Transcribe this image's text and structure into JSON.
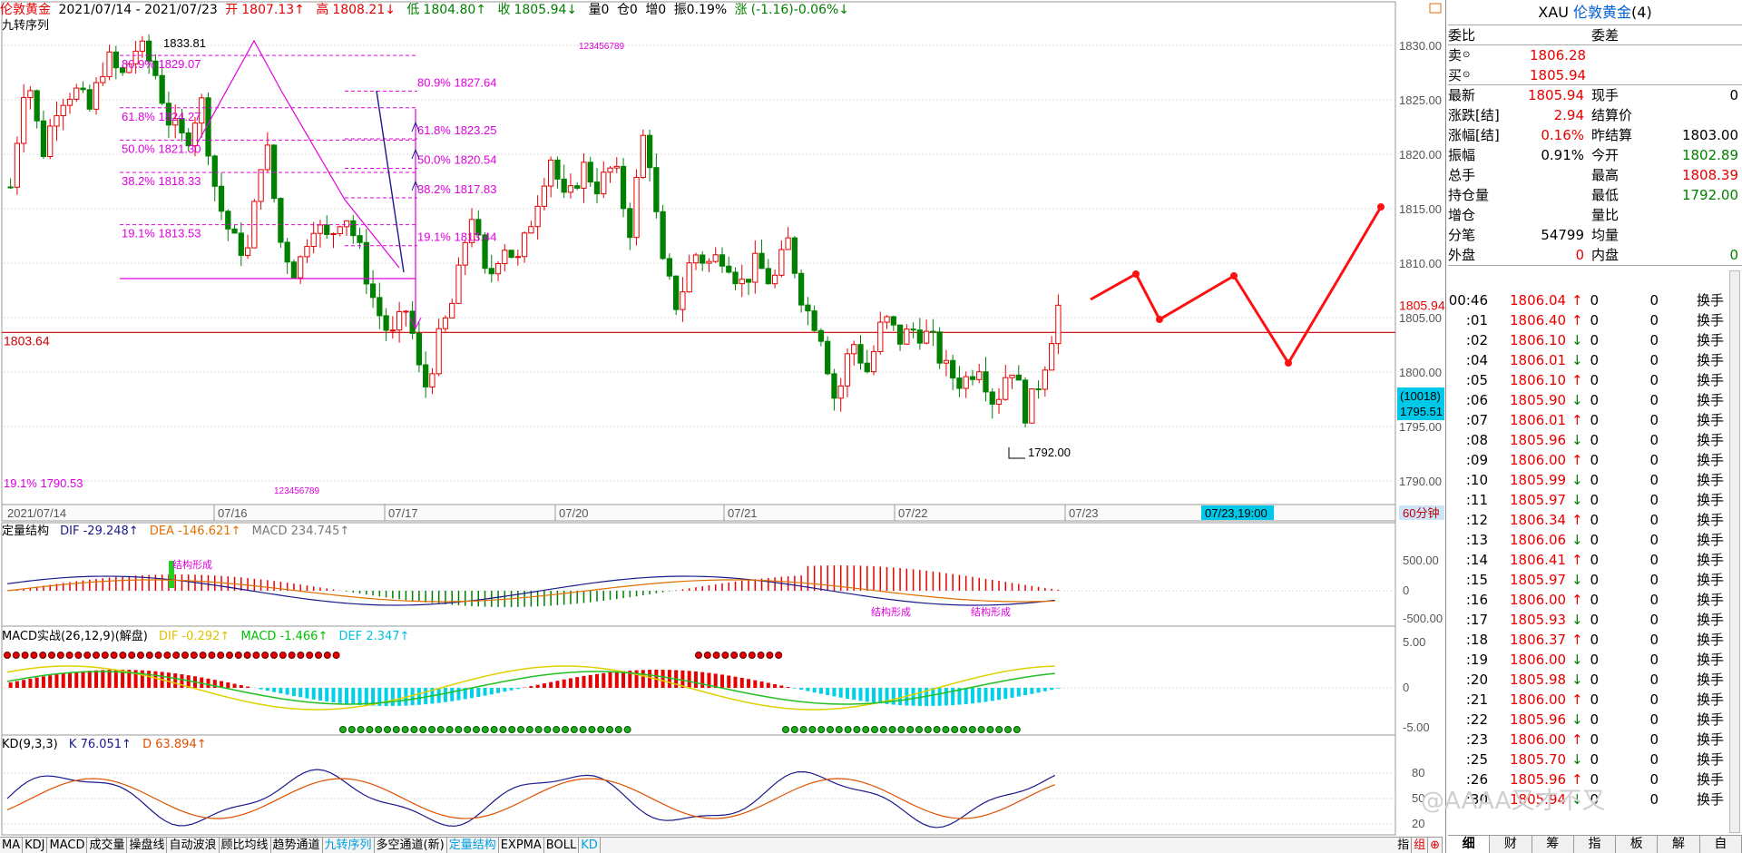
{
  "header": {
    "symbol": "伦敦黄金",
    "range": "2021/07/14 - 2021/07/23",
    "open_label": "开",
    "open": "1807.13↑",
    "high_label": "高",
    "high": "1808.21↓",
    "low_label": "低",
    "low": "1804.80↑",
    "close_label": "收",
    "close": "1805.94↓",
    "vol": "量0",
    "pos": "仓0",
    "inc": "增0",
    "amp": "振0.19%",
    "chg_label": "涨",
    "chg": "(-1.16)-0.06%↓",
    "indicator": "九转序列"
  },
  "main_chart": {
    "y_ticks": [
      "1830.00",
      "1825.00",
      "1820.00",
      "1815.00",
      "1810.00",
      "1805.00",
      "1800.00",
      "1795.00",
      "1790.00"
    ],
    "dates": [
      "2021/07/14",
      "07/16",
      "07/17",
      "07/20",
      "07/21",
      "07/22",
      "07/23"
    ],
    "period": "60分钟",
    "cursor_time": "07/23,19:00",
    "current_price": "1805.94",
    "ref_price": "1803.64",
    "side_box_top": "(10018)",
    "side_box_bottom": "1795.51",
    "high_mark": "1833.81",
    "low_mark": "1792.00",
    "fib_left": [
      "80.9% 1829.07",
      "61.8% 1824.27",
      "50.0% 1821.30",
      "38.2% 1818.33",
      "19.1% 1813.53"
    ],
    "fib_right": [
      "80.9% 1827.64",
      "61.8% 1823.25",
      "50.0% 1820.54",
      "38.2% 1817.83",
      "19.1% 1813.44"
    ],
    "fib_bottom": "19.1% 1790.53",
    "seq_top": "123456789",
    "seq_bottom": "123456789",
    "colors": {
      "up": "#e60000",
      "down": "#008000",
      "magenta": "#e000e0",
      "navy": "#1a1a8c",
      "ref": "#d00000"
    }
  },
  "macd1": {
    "name": "定量结构",
    "dif": "DIF -29.248↑",
    "dea": "DEA -146.621↑",
    "macd": "MACD 234.745↑",
    "ticks": [
      "500.00",
      "0",
      "-500.00"
    ],
    "notes": [
      "结构形成",
      "结构形成",
      "结构形成"
    ]
  },
  "macd2": {
    "name": "MACD实战(26,12,9)(解盘)",
    "dif": "DIF -0.292↑",
    "macd": "MACD -1.466↑",
    "def": "DEF 2.347↑",
    "ticks": [
      "5.00",
      "0",
      "-5.00"
    ]
  },
  "kd": {
    "name": "KD(9,3,3)",
    "k": "K 76.051↑",
    "d": "D 63.894↑",
    "ticks": [
      "80",
      "50",
      "20"
    ]
  },
  "tabs": [
    "MA",
    "KDJ",
    "MACD",
    "成交量",
    "操盘线",
    "自动波浪",
    "顾比均线",
    "趋势通道",
    "九转序列",
    "多空通道(新)",
    "定量结构",
    "EXPMA",
    "BOLL",
    "KD"
  ],
  "active_tabs": [
    "九转序列",
    "定量结构",
    "KD"
  ],
  "right_tabs_bottom": [
    "指",
    "组"
  ],
  "quote": {
    "title_code": "XAU",
    "title_name": "伦敦黄金",
    "title_count": "(4)",
    "wei_bi": "委比",
    "wei_cha": "委差",
    "sell_label": "卖",
    "sell": "1806.28",
    "buy_label": "买",
    "buy": "1805.94",
    "rows": [
      {
        "l1": "最新",
        "v1": "1805.94",
        "c1": "up",
        "l2": "现手",
        "v2": "0",
        "c2": "black"
      },
      {
        "l1": "涨跌[结]",
        "v1": "2.94",
        "c1": "up",
        "l2": "结算价",
        "v2": "",
        "c2": "black"
      },
      {
        "l1": "涨幅[结]",
        "v1": "0.16%",
        "c1": "up",
        "l2": "昨结算",
        "v2": "1803.00",
        "c2": "black"
      },
      {
        "l1": "振幅",
        "v1": "0.91%",
        "c1": "black",
        "l2": "今开",
        "v2": "1802.89",
        "c2": "dn"
      },
      {
        "l1": "总手",
        "v1": "",
        "c1": "black",
        "l2": "最高",
        "v2": "1808.39",
        "c2": "up"
      },
      {
        "l1": "持仓量",
        "v1": "",
        "c1": "black",
        "l2": "最低",
        "v2": "1792.00",
        "c2": "dn"
      },
      {
        "l1": "增仓",
        "v1": "",
        "c1": "black",
        "l2": "量比",
        "v2": "",
        "c2": "black"
      },
      {
        "l1": "分笔",
        "v1": "54799",
        "c1": "black",
        "l2": "均量",
        "v2": "",
        "c2": "black"
      },
      {
        "l1": "外盘",
        "v1": "0",
        "c1": "up",
        "l2": "内盘",
        "v2": "0",
        "c2": "dn"
      }
    ],
    "ticks": [
      {
        "t": "00:46",
        "p": "1806.04",
        "a": "↑",
        "v": "0",
        "o": "0",
        "k": "换手"
      },
      {
        "t": ":01",
        "p": "1806.40",
        "a": "↑",
        "v": "0",
        "o": "0",
        "k": "换手"
      },
      {
        "t": ":02",
        "p": "1806.10",
        "a": "↓",
        "v": "0",
        "o": "0",
        "k": "换手"
      },
      {
        "t": ":04",
        "p": "1806.01",
        "a": "↓",
        "v": "0",
        "o": "0",
        "k": "换手"
      },
      {
        "t": ":05",
        "p": "1806.10",
        "a": "↑",
        "v": "0",
        "o": "0",
        "k": "换手"
      },
      {
        "t": ":06",
        "p": "1805.90",
        "a": "↓",
        "v": "0",
        "o": "0",
        "k": "换手"
      },
      {
        "t": ":07",
        "p": "1806.01",
        "a": "↑",
        "v": "0",
        "o": "0",
        "k": "换手"
      },
      {
        "t": ":08",
        "p": "1805.96",
        "a": "↓",
        "v": "0",
        "o": "0",
        "k": "换手"
      },
      {
        "t": ":09",
        "p": "1806.00",
        "a": "↑",
        "v": "0",
        "o": "0",
        "k": "换手"
      },
      {
        "t": ":10",
        "p": "1805.99",
        "a": "↓",
        "v": "0",
        "o": "0",
        "k": "换手"
      },
      {
        "t": ":11",
        "p": "1805.97",
        "a": "↓",
        "v": "0",
        "o": "0",
        "k": "换手"
      },
      {
        "t": ":12",
        "p": "1806.34",
        "a": "↑",
        "v": "0",
        "o": "0",
        "k": "换手"
      },
      {
        "t": ":13",
        "p": "1806.06",
        "a": "↓",
        "v": "0",
        "o": "0",
        "k": "换手"
      },
      {
        "t": ":14",
        "p": "1806.41",
        "a": "↑",
        "v": "0",
        "o": "0",
        "k": "换手"
      },
      {
        "t": ":15",
        "p": "1805.97",
        "a": "↓",
        "v": "0",
        "o": "0",
        "k": "换手"
      },
      {
        "t": ":16",
        "p": "1806.00",
        "a": "↑",
        "v": "0",
        "o": "0",
        "k": "换手"
      },
      {
        "t": ":17",
        "p": "1805.93",
        "a": "↓",
        "v": "0",
        "o": "0",
        "k": "换手"
      },
      {
        "t": ":18",
        "p": "1806.37",
        "a": "↑",
        "v": "0",
        "o": "0",
        "k": "换手"
      },
      {
        "t": ":19",
        "p": "1806.00",
        "a": "↓",
        "v": "0",
        "o": "0",
        "k": "换手"
      },
      {
        "t": ":20",
        "p": "1805.98",
        "a": "↓",
        "v": "0",
        "o": "0",
        "k": "换手"
      },
      {
        "t": ":21",
        "p": "1806.00",
        "a": "↑",
        "v": "0",
        "o": "0",
        "k": "换手"
      },
      {
        "t": ":22",
        "p": "1805.96",
        "a": "↓",
        "v": "0",
        "o": "0",
        "k": "换手"
      },
      {
        "t": ":23",
        "p": "1806.00",
        "a": "↑",
        "v": "0",
        "o": "0",
        "k": "换手"
      },
      {
        "t": ":25",
        "p": "1805.70",
        "a": "↓",
        "v": "0",
        "o": "0",
        "k": "换手"
      },
      {
        "t": ":26",
        "p": "1805.96",
        "a": "↑",
        "v": "0",
        "o": "0",
        "k": "换手"
      },
      {
        "t": ":30",
        "p": "1805.94",
        "a": "↓",
        "v": "0",
        "o": "0",
        "k": "换手"
      }
    ],
    "bottom_tabs": [
      "细",
      "财",
      "筹",
      "指",
      "板",
      "解",
      "自"
    ],
    "watermark": "@AAAA又才不又"
  }
}
